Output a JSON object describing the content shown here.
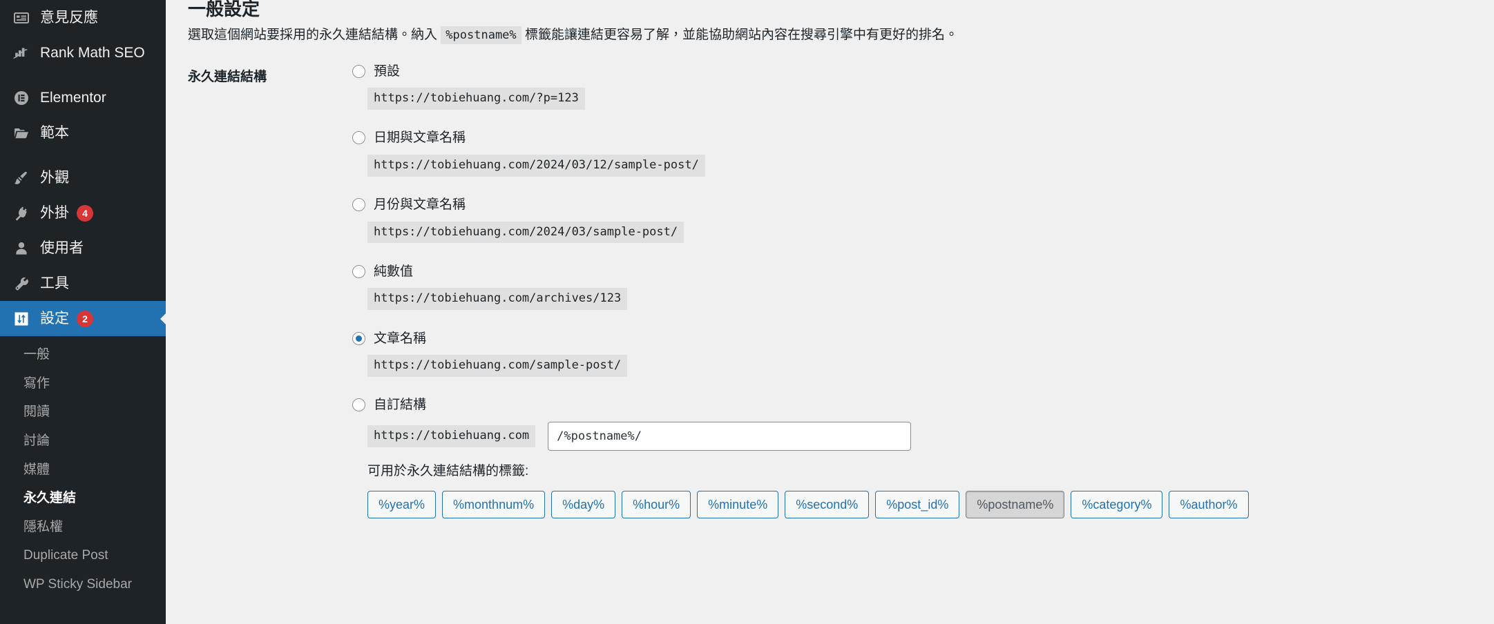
{
  "sidebar": {
    "top_items": [
      {
        "label": "意見反應",
        "icon": "feedback-icon",
        "badge": null,
        "current": false,
        "separator_above": false
      },
      {
        "label": "Rank Math SEO",
        "icon": "rank-math-icon",
        "badge": null,
        "current": false,
        "separator_above": false
      },
      {
        "label": "Elementor",
        "icon": "elementor-icon",
        "badge": null,
        "current": false,
        "separator_above": true
      },
      {
        "label": "範本",
        "icon": "folder-icon",
        "badge": null,
        "current": false,
        "separator_above": false
      },
      {
        "label": "外觀",
        "icon": "paintbrush-icon",
        "badge": null,
        "current": false,
        "separator_above": true
      },
      {
        "label": "外掛",
        "icon": "plug-icon",
        "badge": "4",
        "current": false,
        "separator_above": false
      },
      {
        "label": "使用者",
        "icon": "user-icon",
        "badge": null,
        "current": false,
        "separator_above": false
      },
      {
        "label": "工具",
        "icon": "wrench-icon",
        "badge": null,
        "current": false,
        "separator_above": false
      },
      {
        "label": "設定",
        "icon": "settings-sliders-icon",
        "badge": "2",
        "current": true,
        "separator_above": false
      }
    ],
    "submenu": [
      {
        "label": "一般",
        "current": false
      },
      {
        "label": "寫作",
        "current": false
      },
      {
        "label": "閱讀",
        "current": false
      },
      {
        "label": "討論",
        "current": false
      },
      {
        "label": "媒體",
        "current": false
      },
      {
        "label": "永久連結",
        "current": true
      },
      {
        "label": "隱私權",
        "current": false
      },
      {
        "label": "Duplicate Post",
        "current": false
      },
      {
        "label": "WP Sticky Sidebar",
        "current": false
      }
    ]
  },
  "main": {
    "page_title": "一般設定",
    "description": {
      "before": "選取這個網站要採用的永久連結結構。納入",
      "code": "%postname%",
      "after": "標籤能讓連結更容易了解，並能協助網站內容在搜尋引擎中有更好的排名。"
    },
    "field_label": "永久連結結構",
    "options": [
      {
        "label": "預設",
        "example": "https://tobiehuang.com/?p=123",
        "selected": false
      },
      {
        "label": "日期與文章名稱",
        "example": "https://tobiehuang.com/2024/03/12/sample-post/",
        "selected": false
      },
      {
        "label": "月份與文章名稱",
        "example": "https://tobiehuang.com/2024/03/sample-post/",
        "selected": false
      },
      {
        "label": "純數值",
        "example": "https://tobiehuang.com/archives/123",
        "selected": false
      },
      {
        "label": "文章名稱",
        "example": "https://tobiehuang.com/sample-post/",
        "selected": true
      }
    ],
    "custom": {
      "label": "自訂結構",
      "selected": false,
      "prefix": "https://tobiehuang.com",
      "value": "/%postname%/",
      "placeholder": ""
    },
    "available_tags_label": "可用於永久連結結構的標籤:",
    "tags": [
      {
        "label": "%year%",
        "active": false
      },
      {
        "label": "%monthnum%",
        "active": false
      },
      {
        "label": "%day%",
        "active": false
      },
      {
        "label": "%hour%",
        "active": false
      },
      {
        "label": "%minute%",
        "active": false
      },
      {
        "label": "%second%",
        "active": false
      },
      {
        "label": "%post_id%",
        "active": false
      },
      {
        "label": "%postname%",
        "active": true
      },
      {
        "label": "%category%",
        "active": false
      },
      {
        "label": "%author%",
        "active": false
      }
    ]
  },
  "colors": {
    "sidebar_bg": "#1d2327",
    "accent": "#2271b1",
    "badge": "#d63638",
    "page_bg": "#f0f0f1",
    "code_bg": "#e0e0e0"
  }
}
